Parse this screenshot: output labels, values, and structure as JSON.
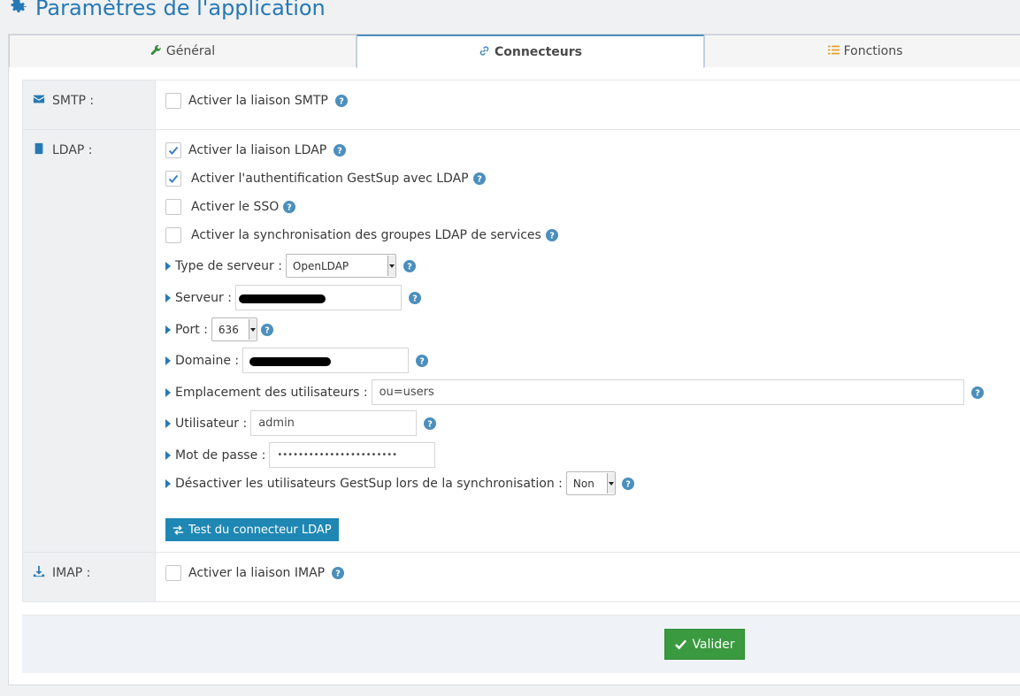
{
  "page": {
    "title": "Paramètres de l'application"
  },
  "tabs": [
    {
      "label": "Général",
      "icon": "wrench-icon",
      "color": "#3a8a3a"
    },
    {
      "label": "Connecteurs",
      "icon": "link-icon",
      "color": "#4c8fbd",
      "active": true
    },
    {
      "label": "Fonctions",
      "icon": "list-icon",
      "color": "#e09e1a"
    }
  ],
  "smtp": {
    "label": "SMTP :",
    "icon": "envelope-icon",
    "enable_label": "Activer la liaison SMTP",
    "enabled": false
  },
  "ldap": {
    "label": "LDAP :",
    "icon": "book-icon",
    "enable_label": "Activer la liaison LDAP",
    "enabled": true,
    "auth_label": "Activer l'authentification GestSup avec LDAP",
    "auth_enabled": true,
    "sso_label": "Activer le SSO",
    "sso_enabled": false,
    "sync_label": "Activer la synchronisation des groupes LDAP de services",
    "sync_enabled": false,
    "server_type_label": "Type de serveur :",
    "server_type_value": "OpenLDAP",
    "server_label": "Serveur :",
    "port_label": "Port :",
    "port_value": "636",
    "domain_label": "Domaine :",
    "users_location_label": "Emplacement des utilisateurs :",
    "users_location_value": "ou=users",
    "user_label": "Utilisateur :",
    "user_value": "admin",
    "password_label": "Mot de passe :",
    "password_value": "•••••••••••••••••••••••",
    "disable_label": "Désactiver les utilisateurs GestSup lors de la synchronisation :",
    "disable_value": "Non",
    "test_button": "Test du connecteur LDAP"
  },
  "imap": {
    "label": "IMAP :",
    "icon": "download-icon",
    "enable_label": "Activer la liaison IMAP",
    "enabled": false
  },
  "footer": {
    "submit_label": "Valider"
  },
  "colors": {
    "primary": "#2679b5",
    "help": "#4c8fbd",
    "checkmark": "#3b7fc4",
    "info_button": "#1e87b4",
    "success_button": "#3a9a40"
  }
}
